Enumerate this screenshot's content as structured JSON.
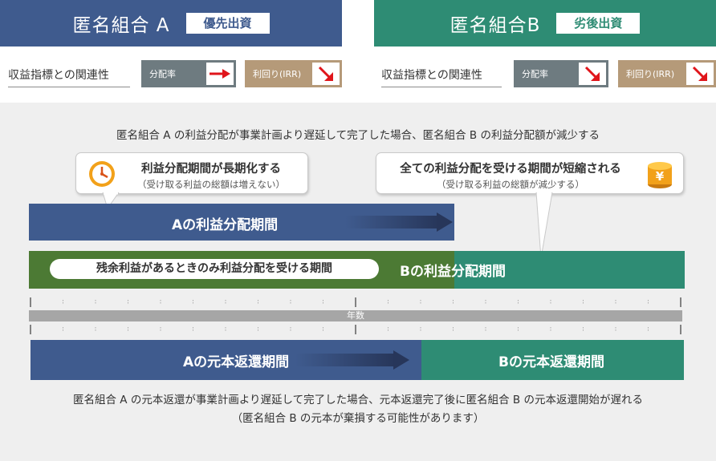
{
  "cards": {
    "a": {
      "title": "匿名組合 A",
      "tag": "優先出資"
    },
    "b": {
      "title": "匿名組合B",
      "tag": "劣後出資"
    }
  },
  "relation_label": "収益指標との関連性",
  "indicators": {
    "dist_label": "分配率",
    "irr_label": "利回り(IRR)",
    "a": {
      "dist": "up",
      "irr": "down"
    },
    "b": {
      "dist": "down",
      "irr": "down"
    }
  },
  "diagram": {
    "top_heading": "匿名組合 A の利益分配が事業計画より遅延して完了した場合、匿名組合 B の利益分配額が減少する",
    "bubble_a": {
      "main": "利益分配期間が長期化する",
      "sub": "（受け取る利益の総額は増えない）"
    },
    "bubble_b": {
      "main": "全ての利益分配を受ける期間が短縮される",
      "sub": "（受け取る利益の総額が減少する）"
    },
    "profit_a": "Aの利益分配期間",
    "profit_b": "Bの利益分配期間",
    "residual_pill": "残余利益があるときのみ利益分配を受ける期間",
    "year_label": "年数",
    "principal_a": "Aの元本返還期間",
    "principal_b": "Bの元本返還期間",
    "bottom_note_1": "匿名組合 A の元本返還が事業計画より遅延して完了した場合、元本返還完了後に匿名組合 B の元本返還開始が遅れる",
    "bottom_note_2": "（匿名組合 B の元本が棄損する可能性があります）",
    "yen_symbol": "¥"
  },
  "colors": {
    "a_blue": "#3f5b8e",
    "b_teal": "#2e8c74",
    "green": "#4c7a34",
    "arrow_red": "#e0151b",
    "gold": "#f2a11a"
  }
}
